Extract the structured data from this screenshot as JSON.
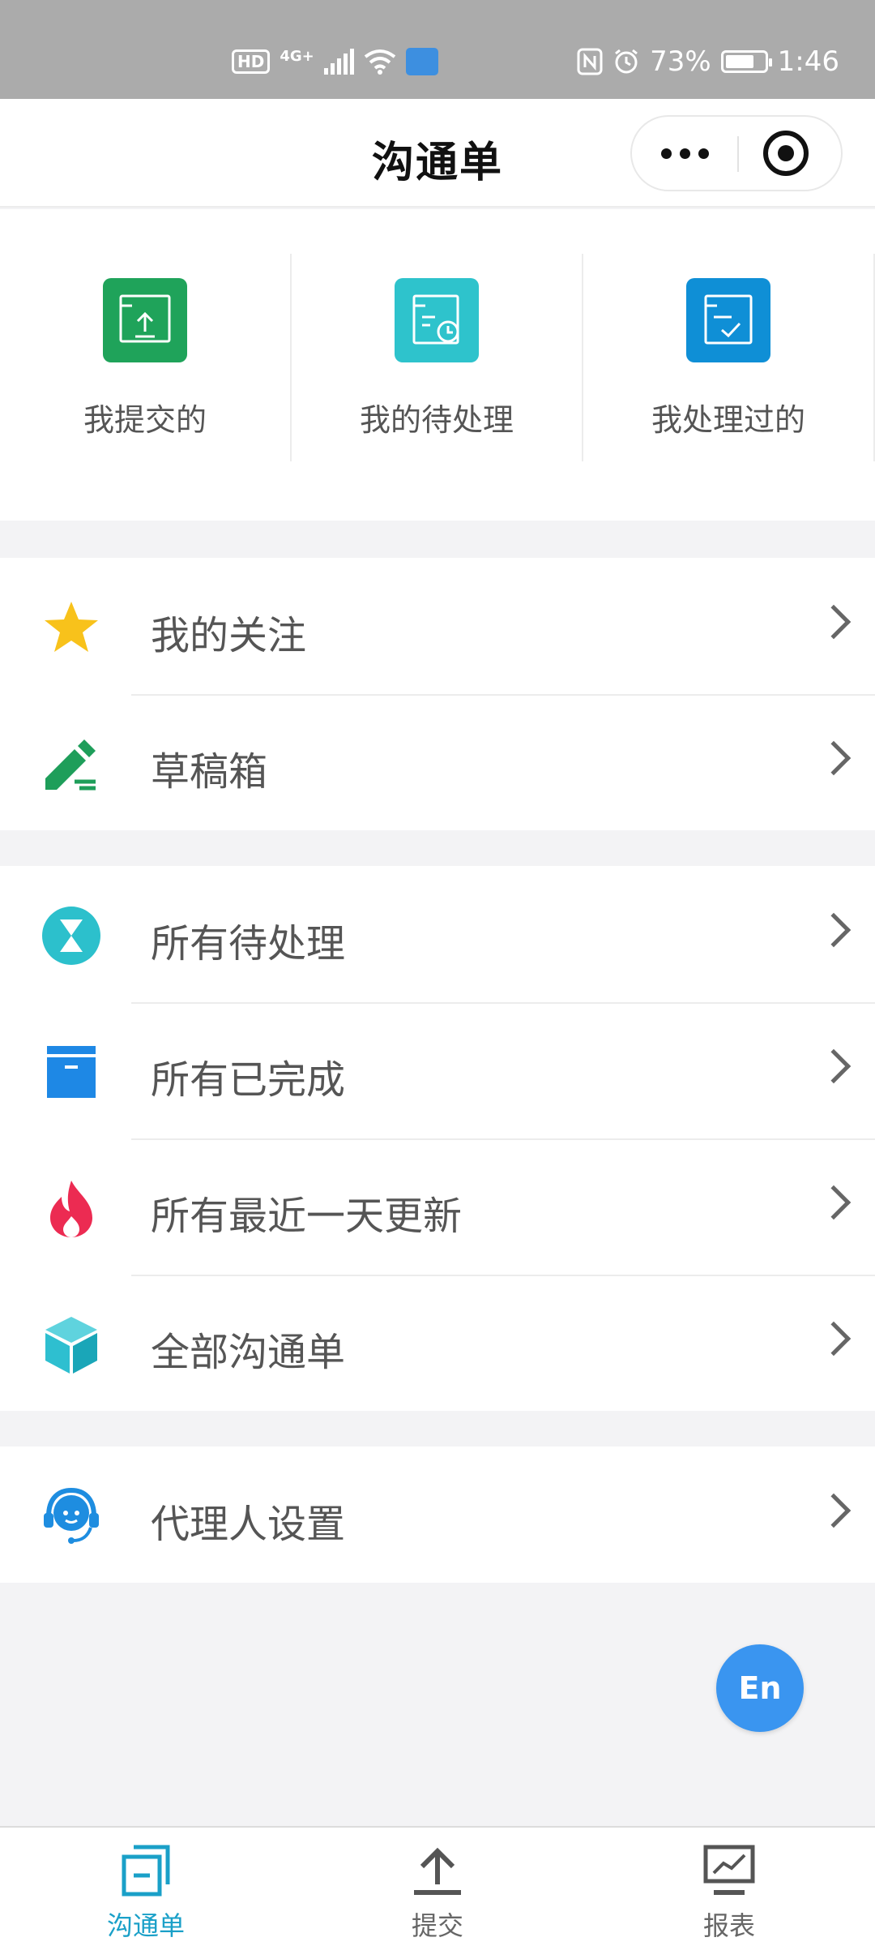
{
  "status_bar": {
    "hd": "HD",
    "network": "4G+",
    "battery_percent": "73%",
    "battery_level": 0.73,
    "time": "1:46"
  },
  "nav": {
    "title": "沟通单"
  },
  "quick_actions": [
    {
      "label": "我提交的",
      "icon": "submit-upload-icon",
      "color": "#1fa35a"
    },
    {
      "label": "我的待处理",
      "icon": "pending-clock-icon",
      "color": "#2ec3cc"
    },
    {
      "label": "我处理过的",
      "icon": "processed-check-icon",
      "color": "#0f8fd6"
    }
  ],
  "menu_groups": [
    [
      {
        "label": "我的关注",
        "icon": "star-icon",
        "color": "#f8c21b"
      },
      {
        "label": "草稿箱",
        "icon": "pencil-icon",
        "color": "#1e9e5a"
      }
    ],
    [
      {
        "label": "所有待处理",
        "icon": "hourglass-icon",
        "color": "#2cc0cc"
      },
      {
        "label": "所有已完成",
        "icon": "archive-box-icon",
        "color": "#1e88e5"
      },
      {
        "label": "所有最近一天更新",
        "icon": "flame-icon",
        "color": "#ec2b52"
      },
      {
        "label": "全部沟通单",
        "icon": "cube-icon",
        "color": "#2ebfd0"
      }
    ],
    [
      {
        "label": "代理人设置",
        "icon": "headset-agent-icon",
        "color": "#1e8de0"
      }
    ]
  ],
  "language_button": {
    "label": "En",
    "color": "#3a95f0"
  },
  "tab_bar": [
    {
      "label": "沟通单",
      "icon": "tickets-icon",
      "active": true
    },
    {
      "label": "提交",
      "icon": "upload-icon",
      "active": false
    },
    {
      "label": "报表",
      "icon": "report-chart-icon",
      "active": false
    }
  ],
  "colors": {
    "accent": "#1aa0c8",
    "background": "#f3f3f5"
  }
}
